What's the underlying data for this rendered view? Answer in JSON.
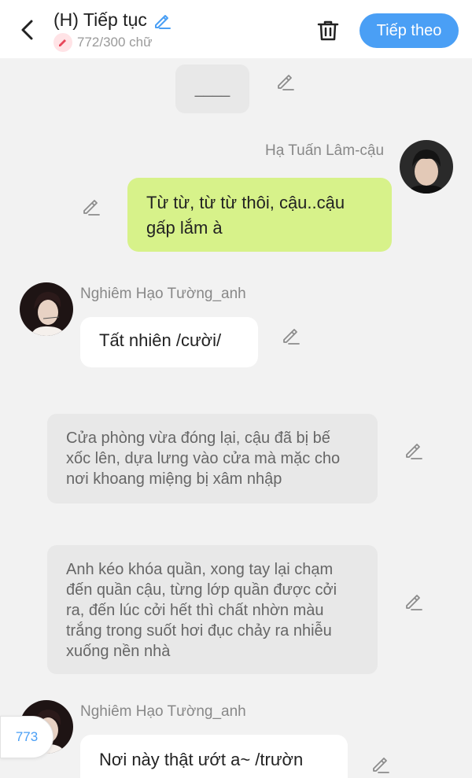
{
  "header": {
    "title": "(H) Tiếp tục",
    "word_count": "772/300 chữ",
    "next_label": "Tiếp theo"
  },
  "messages": {
    "m1_text": "____",
    "m2_speaker": "Hạ Tuấn Lâm-cậu",
    "m2_text": "Từ từ, từ từ thôi, cậu..cậu gấp lắm à",
    "m3_speaker": "Nghiêm Hạo Tường_anh",
    "m3_text": "Tất nhiên /cười/",
    "m4_text": "Cửa phòng vừa đóng lại, cậu đã bị bế xốc lên, dựa lưng vào cửa mà mặc cho nơi khoang miệng bị xâm nhập",
    "m5_text": "Anh kéo khóa quần, xong tay lại chạm đến quần cậu, từng lớp quần được cởi ra, đến lúc cởi hết thì chất nhờn màu trắng trong suốt hơi đục chảy ra nhiễu xuống nền nhà",
    "m6_speaker": "Nghiêm Hạo Tường_anh",
    "m6_text": "Nơi này thật ướt a~ /trườn"
  },
  "floating_count": "773",
  "icons": {
    "back": "chevron-left-icon",
    "title_edit": "pencil-icon",
    "badge": "pencil-icon",
    "trash": "trash-icon",
    "message_edit": "pencil-icon"
  },
  "colors": {
    "accent": "#4a9ff5",
    "green_bubble": "#d7f28a",
    "narration_bg": "#e8e8e8"
  }
}
